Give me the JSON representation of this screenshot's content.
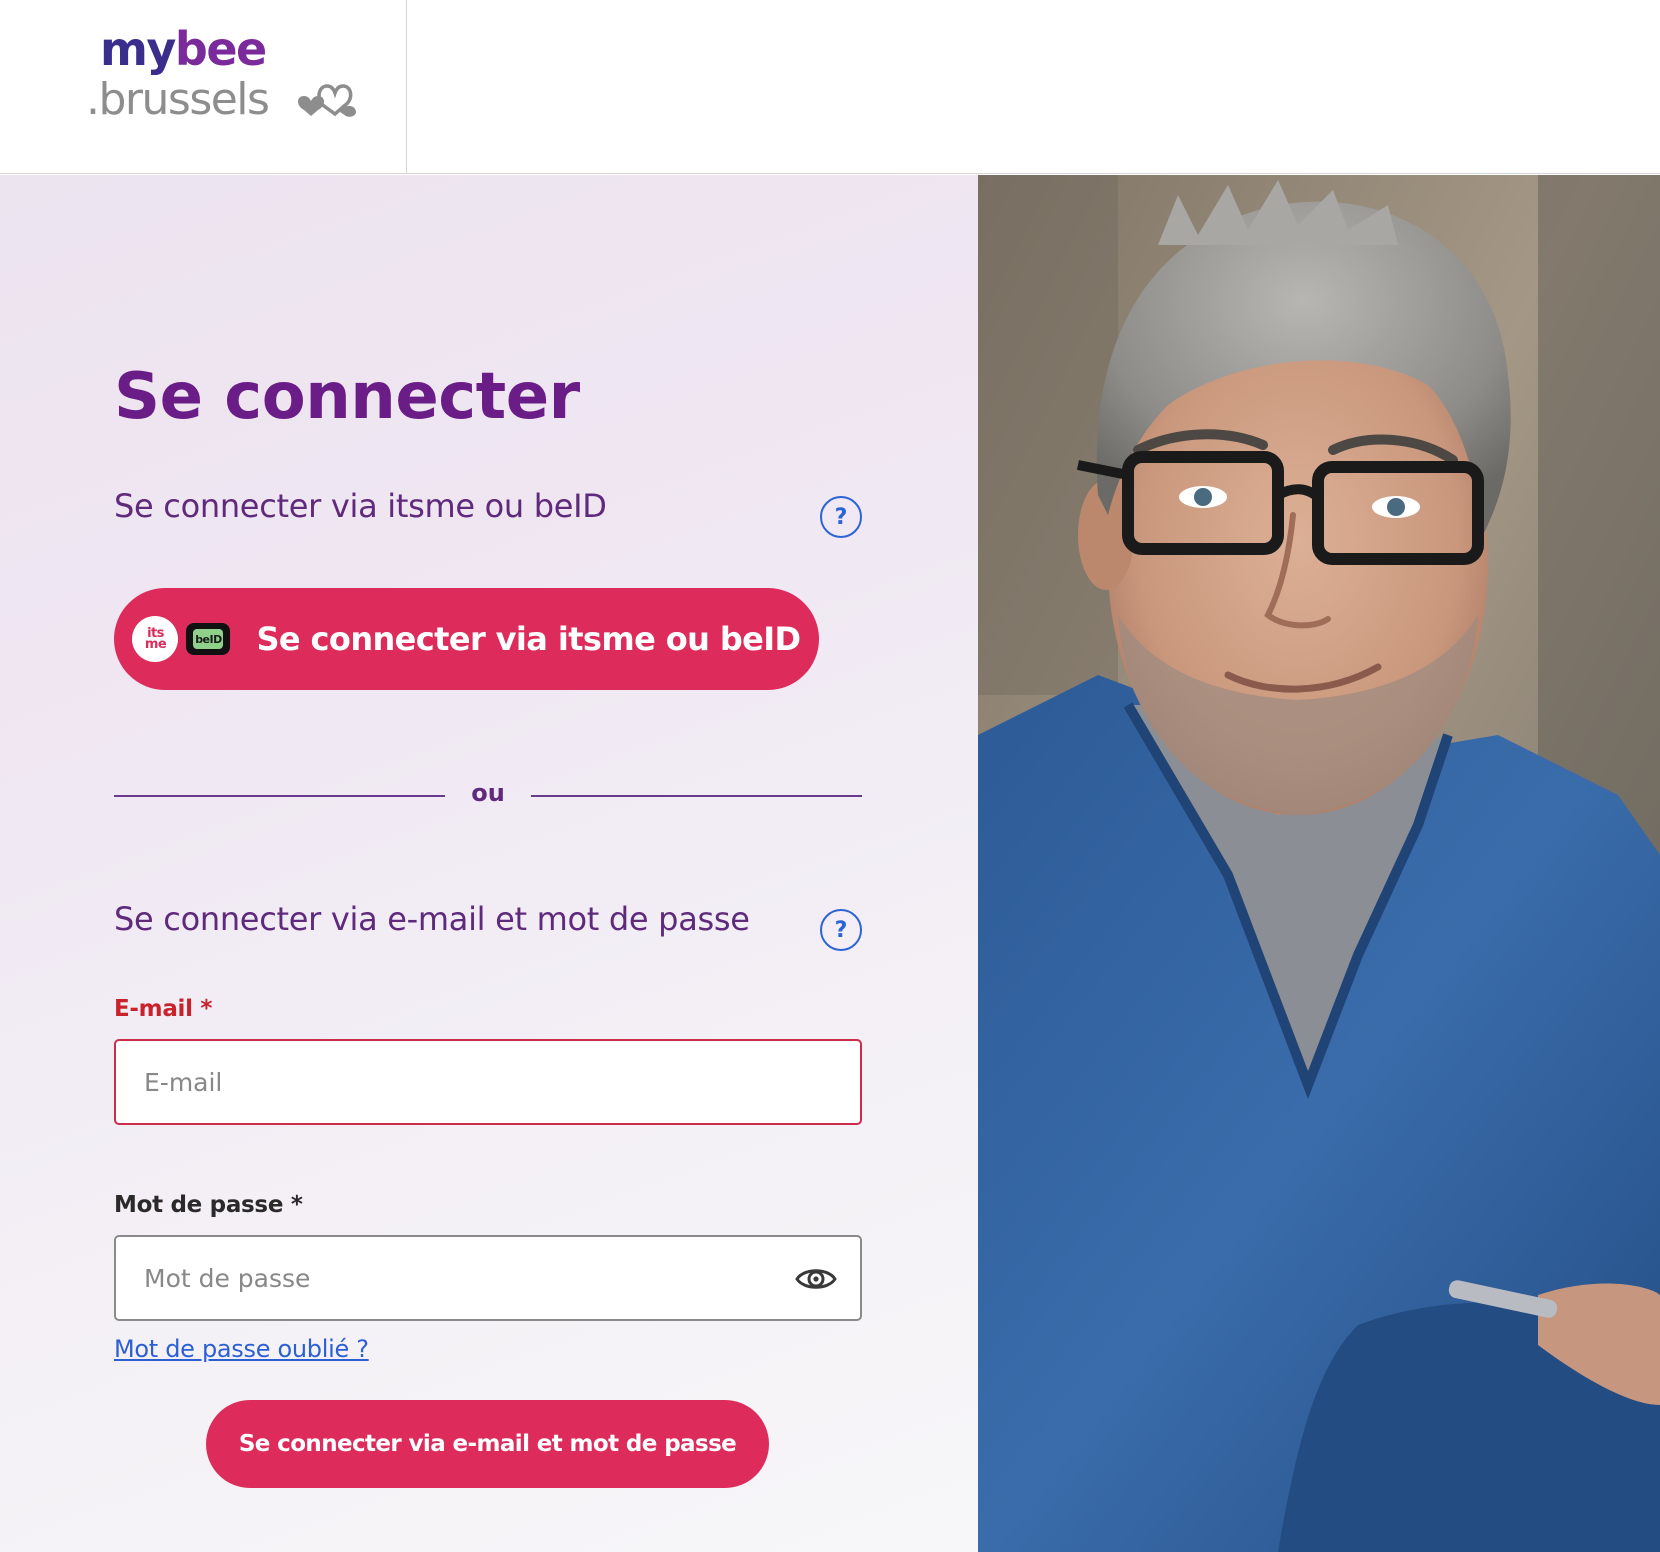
{
  "header": {
    "logo_line1_a": "my",
    "logo_line1_b": "bee",
    "logo_line2": ".brussels"
  },
  "login": {
    "title": "Se connecter",
    "itsme_section": {
      "heading": "Se connecter via itsme ou beID",
      "help_icon": "?",
      "button_label": "Se connecter via itsme ou beID",
      "itsme_icon_top": "its",
      "itsme_icon_bottom": "me",
      "beid_icon_text": "beID"
    },
    "divider_text": "ou",
    "email_section": {
      "heading": "Se connecter via e-mail et mot de passe",
      "help_icon": "?",
      "email_label": "E-mail *",
      "email_placeholder": "E-mail",
      "email_value": "",
      "password_label": "Mot de passe *",
      "password_placeholder": "Mot de passe",
      "password_value": "",
      "forgot_link": "Mot de passe oublié ?",
      "submit_label": "Se connecter via e-mail et mot de passe"
    }
  },
  "colors": {
    "brand_purple": "#6a1d86",
    "accent_pink": "#dd2c5b",
    "error_red": "#c8232c",
    "link_blue": "#2c5fd4"
  },
  "icons": {
    "help": "question-circle-icon",
    "password_toggle": "eye-icon",
    "logo_mark": "hearts-icon"
  }
}
